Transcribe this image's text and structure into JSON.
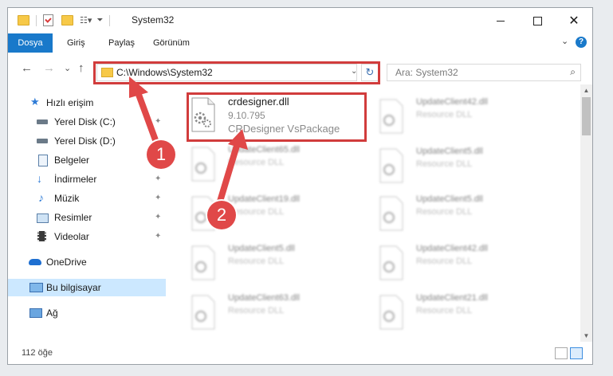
{
  "window": {
    "title": "System32",
    "controls": {
      "minimize": "—",
      "maximize": "□",
      "close": "✕"
    }
  },
  "ribbon": {
    "tabs": [
      "Dosya",
      "Giriş",
      "Paylaş",
      "Görünüm"
    ],
    "help_icon": "question-icon",
    "help_label": "?",
    "expand_icon": "chevron-down-icon"
  },
  "address": {
    "back": "←",
    "forward": "→",
    "recent": "⌄",
    "up": "↑",
    "path": "C:\\Windows\\System32",
    "refresh": "↻",
    "dropdown": "⌄"
  },
  "search": {
    "placeholder": "Ara: System32",
    "icon": "⌕"
  },
  "sidebar": {
    "items": [
      {
        "label": "Hızlı erişim",
        "icon": "star-icon"
      },
      {
        "label": "Yerel Disk (C:)",
        "icon": "drive-icon",
        "pinned": true
      },
      {
        "label": "Yerel Disk (D:)",
        "icon": "drive-icon"
      },
      {
        "label": "Belgeler",
        "icon": "documents-icon"
      },
      {
        "label": "İndirmeler",
        "icon": "downloads-icon",
        "pinned": true
      },
      {
        "label": "Müzik",
        "icon": "music-icon",
        "pinned": true
      },
      {
        "label": "Resimler",
        "icon": "pictures-icon",
        "pinned": true
      },
      {
        "label": "Videolar",
        "icon": "videos-icon",
        "pinned": true
      },
      {
        "label": "OneDrive",
        "icon": "cloud-icon"
      },
      {
        "label": "Bu bilgisayar",
        "icon": "computer-icon",
        "selected": true
      },
      {
        "label": "Ağ",
        "icon": "network-icon"
      }
    ],
    "pin_glyph": "📌"
  },
  "files": {
    "highlighted": {
      "name": "crdesigner.dll",
      "version": "9.10.795",
      "description": "CRDesigner VsPackage"
    },
    "blurred_left": [
      {
        "name": "UpdateClient65.dll",
        "type": "Resource DLL"
      },
      {
        "name": "UpdateClient19.dll",
        "type": "Resource DLL"
      },
      {
        "name": "UpdateClient5.dll",
        "type": "Resource DLL"
      },
      {
        "name": "UpdateClient63.dll",
        "type": "Resource DLL"
      }
    ],
    "blurred_right": [
      {
        "name": "UpdateClient42.dll",
        "type": "Resource DLL"
      },
      {
        "name": "UpdateClient5.dll",
        "type": "Resource DLL"
      },
      {
        "name": "UpdateClient5.dll",
        "type": "Resource DLL"
      },
      {
        "name": "UpdateClient42.dll",
        "type": "Resource DLL"
      },
      {
        "name": "UpdateClient21.dll",
        "type": "Resource DLL"
      }
    ]
  },
  "status": {
    "count": "112 öğe"
  },
  "annotations": {
    "badge1": "1",
    "badge2": "2",
    "accent": "#e04848"
  },
  "colors": {
    "accent_blue": "#1979ca",
    "selection": "#cce8ff",
    "highlight_red": "#d13c3c"
  }
}
